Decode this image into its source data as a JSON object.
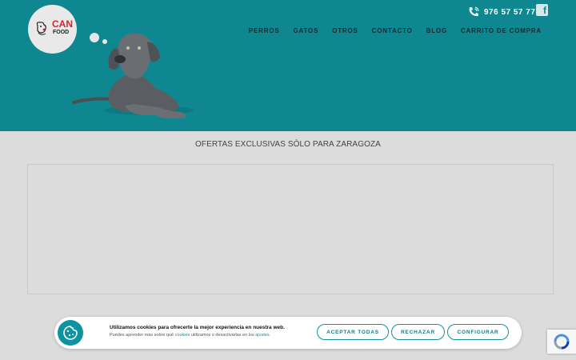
{
  "brand": {
    "line1": "CAN",
    "line2": "FOOD"
  },
  "header": {
    "phone": "976 57 57 77",
    "facebook_glyph": "f",
    "colors": {
      "teal": "#0f8791",
      "nav_text": "#1b2b2d"
    }
  },
  "nav": {
    "items": [
      {
        "label": "PERROS"
      },
      {
        "label": "GATOS"
      },
      {
        "label": "OTROS"
      },
      {
        "label": "CONTACTO"
      },
      {
        "label": "BLOG"
      },
      {
        "label": "CARRITO DE COMPRA"
      }
    ]
  },
  "main": {
    "title": "OFERTAS EXCLUSIVAS SÓLO PARA ZARAGOZA"
  },
  "cookie_bar": {
    "title": "Utilizamos cookies para ofrecerte la mejor experiencia en nuestra web.",
    "sub_prefix": "Puedes aprender más sobre qué ",
    "sub_link1": "cookies",
    "sub_middle": " utilizamos o desactivarlas en los ",
    "sub_link2": "ajustes",
    "sub_suffix": ".",
    "accept": "ACEPTAR TODAS",
    "reject": "RECHAZAR",
    "configure": "CONFIGURAR",
    "accent": "#0d94a0"
  }
}
